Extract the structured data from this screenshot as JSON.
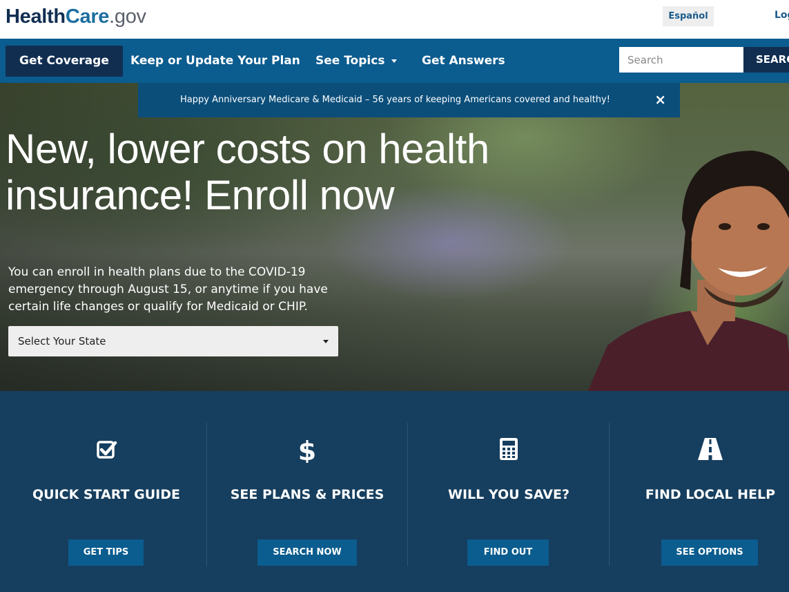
{
  "header": {
    "logo_part1": "Health",
    "logo_part2": "Care",
    "logo_part3": ".gov",
    "language_link": "Español",
    "login_link": "Log"
  },
  "nav": {
    "items": [
      {
        "label": "Get Coverage"
      },
      {
        "label": "Keep or Update Your Plan"
      },
      {
        "label": "See Topics"
      },
      {
        "label": "Get Answers"
      }
    ],
    "search_placeholder": "Search",
    "search_button": "SEARC"
  },
  "banner": {
    "text": "Happy Anniversary Medicare & Medicaid – 56 years of keeping Americans covered and healthy!",
    "close": "×"
  },
  "hero": {
    "headline_line1": "New, lower costs on health",
    "headline_line2": "insurance! Enroll now",
    "subtext": "You can enroll in health plans due to the COVID-19 emergency through August 15, or anytime if you have certain life changes or qualify for Medicaid or CHIP.",
    "state_select": "Select Your State"
  },
  "features": [
    {
      "icon": "checkbox-icon",
      "title": "QUICK START GUIDE",
      "button": "GET TIPS"
    },
    {
      "icon": "dollar-icon",
      "title": "SEE PLANS & PRICES",
      "button": "SEARCH NOW"
    },
    {
      "icon": "calculator-icon",
      "title": "WILL YOU SAVE?",
      "button": "FIND OUT"
    },
    {
      "icon": "road-icon",
      "title": "FIND LOCAL HELP",
      "button": "SEE OPTIONS"
    }
  ],
  "colors": {
    "nav_blue": "#0b5c8f",
    "navy": "#112e51",
    "banner_blue": "#0b4e7a",
    "features_bg": "#163e5e"
  }
}
